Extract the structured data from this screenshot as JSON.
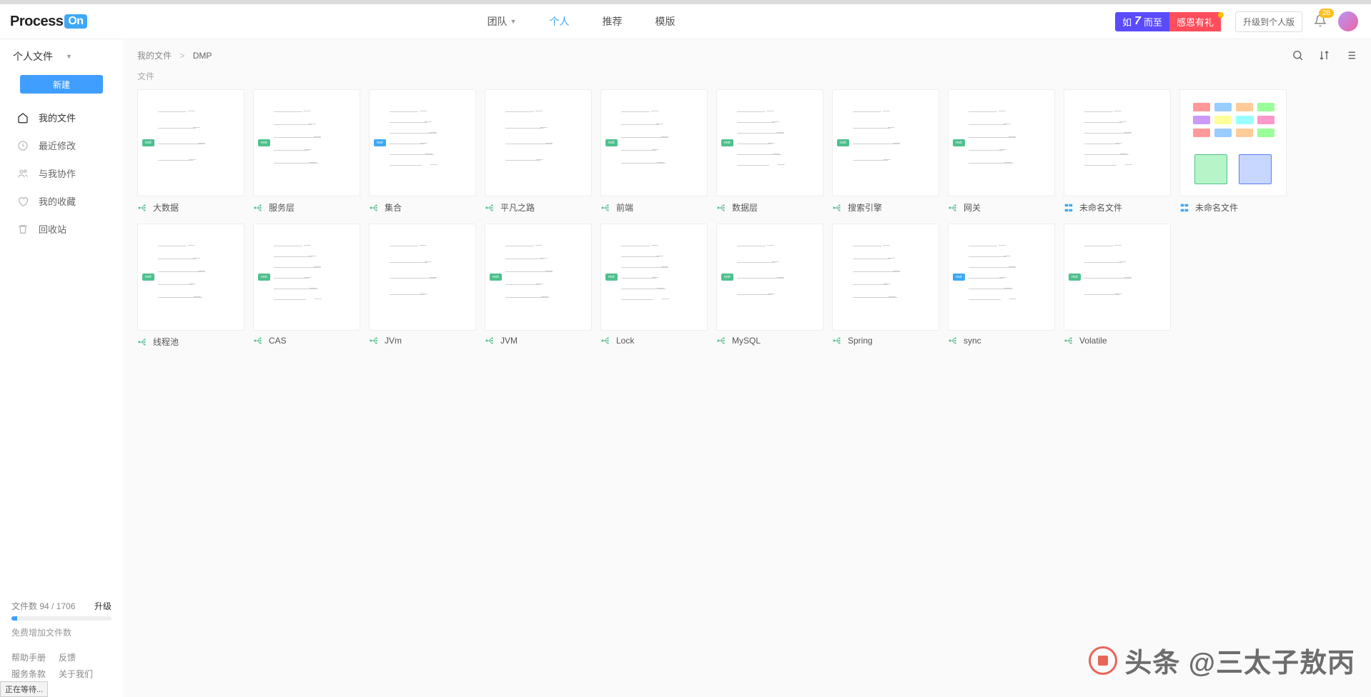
{
  "logo": {
    "a": "Process",
    "b": "On"
  },
  "nav": {
    "team": "团队",
    "personal": "个人",
    "recommend": "推荐",
    "template": "模版"
  },
  "promo": {
    "left_a": "如",
    "seven": "7",
    "left_b": "而至",
    "right": "感恩有礼"
  },
  "upgrade_btn": "升级到个人版",
  "badge_count": "28",
  "sidebar": {
    "selector": "个人文件",
    "new_btn": "新建",
    "items": [
      {
        "icon": "home",
        "label": "我的文件",
        "active": true
      },
      {
        "icon": "clock",
        "label": "最近修改"
      },
      {
        "icon": "users",
        "label": "与我协作"
      },
      {
        "icon": "heart",
        "label": "我的收藏"
      },
      {
        "icon": "trash",
        "label": "回收站"
      }
    ],
    "quota_label": "文件数 94 / 1706",
    "quota_pct": 6,
    "quota_link": "升级",
    "quota_hint": "免费增加文件数",
    "foot1": [
      "帮助手册",
      "反馈"
    ],
    "foot2": [
      "服务条款",
      "关于我们"
    ]
  },
  "status_bar": "正在等待...",
  "breadcrumb": {
    "root": "我的文件",
    "current": "DMP"
  },
  "section_label": "文件",
  "files": [
    {
      "name": "大数据",
      "type": "mind",
      "root_color": "#4fc08d"
    },
    {
      "name": "服务层",
      "type": "mind",
      "root_color": "#4fc08d"
    },
    {
      "name": "集合",
      "type": "mind",
      "root_color": "#3da8f5"
    },
    {
      "name": "平凡之路",
      "type": "mind",
      "root_color": ""
    },
    {
      "name": "前端",
      "type": "mind",
      "root_color": "#4fc08d"
    },
    {
      "name": "数据层",
      "type": "mind",
      "root_color": "#4fc08d"
    },
    {
      "name": "搜索引擎",
      "type": "mind",
      "root_color": "#4fc08d"
    },
    {
      "name": "网关",
      "type": "mind",
      "root_color": "#4fc08d"
    },
    {
      "name": "未命名文件",
      "type": "flow",
      "root_color": ""
    },
    {
      "name": "未命名文件",
      "type": "flow",
      "root_color": ""
    },
    {
      "name": "线程池",
      "type": "mind",
      "root_color": "#4fc08d"
    },
    {
      "name": "CAS",
      "type": "mind",
      "root_color": "#4fc08d"
    },
    {
      "name": "JVm",
      "type": "mind",
      "root_color": ""
    },
    {
      "name": "JVM",
      "type": "mind",
      "root_color": "#4fc08d"
    },
    {
      "name": "Lock",
      "type": "mind",
      "root_color": "#4fc08d"
    },
    {
      "name": "MySQL",
      "type": "mind",
      "root_color": "#4fc08d"
    },
    {
      "name": "Spring",
      "type": "mind",
      "root_color": ""
    },
    {
      "name": "sync",
      "type": "mind",
      "root_color": "#3da8f5"
    },
    {
      "name": "Volatile",
      "type": "mind",
      "root_color": "#4fc08d"
    }
  ],
  "watermark": "头条 @三太子敖丙"
}
